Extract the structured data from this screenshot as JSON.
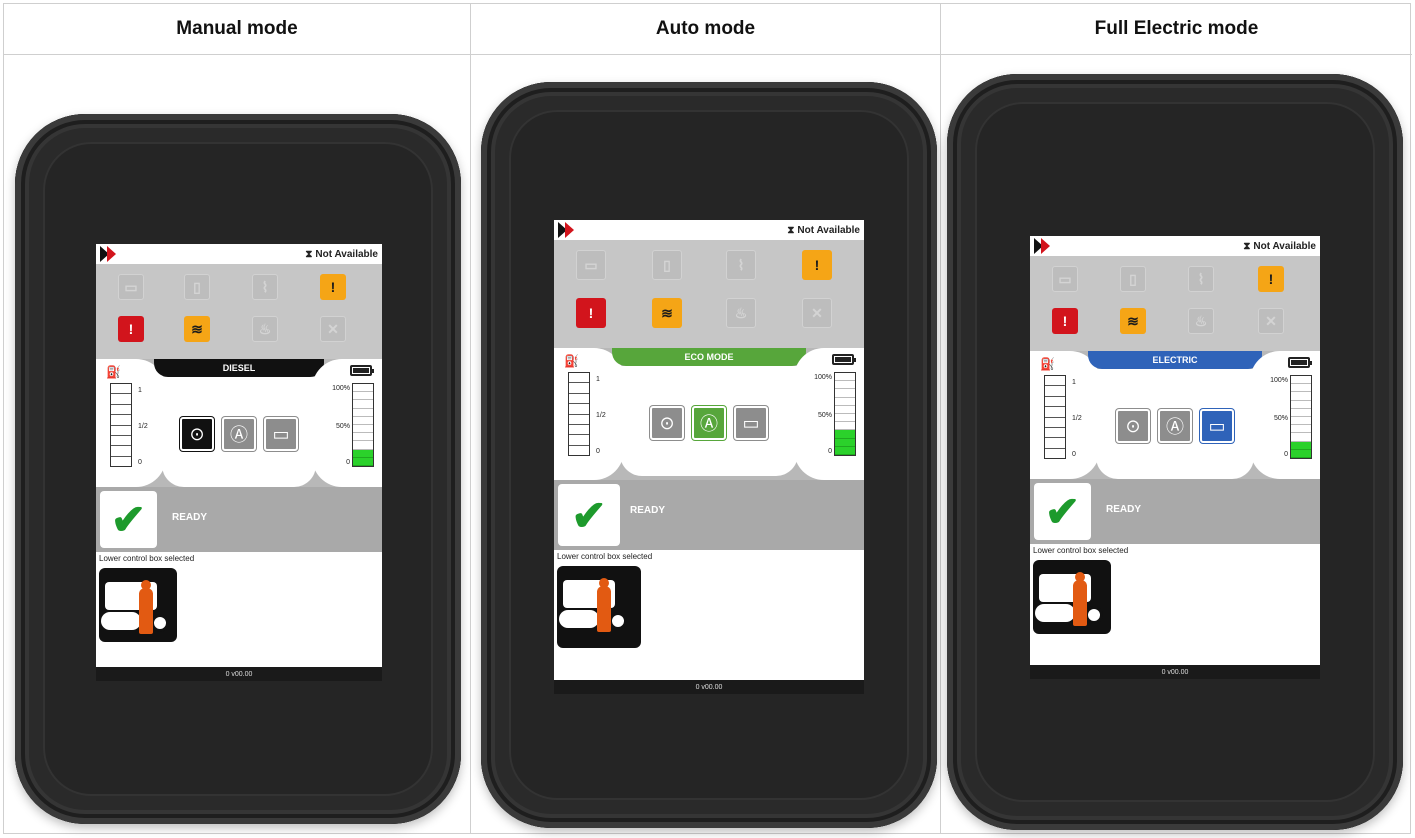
{
  "columns": [
    {
      "heading": "Manual mode",
      "status_text": "Not Available",
      "mode_label": "DIESEL",
      "mode_color": "#111111",
      "active_mode": "diesel",
      "fuel_labels": {
        "full": "1",
        "half": "1/2",
        "empty": "0"
      },
      "battery_labels": {
        "full": "100%",
        "half": "50%",
        "empty": "0"
      },
      "battery_level": 0.2,
      "ready_text": "READY",
      "info_text": "Lower control box selected",
      "footer_text": "0  v00.00"
    },
    {
      "heading": "Auto mode",
      "status_text": "Not Available",
      "mode_label": "ECO MODE",
      "mode_color": "#57a63b",
      "active_mode": "auto",
      "fuel_labels": {
        "full": "1",
        "half": "1/2",
        "empty": "0"
      },
      "battery_labels": {
        "full": "100%",
        "half": "50%",
        "empty": "0"
      },
      "battery_level": 0.3,
      "ready_text": "READY",
      "info_text": "Lower control box selected",
      "footer_text": "0  v00.00"
    },
    {
      "heading": "Full Electric mode",
      "status_text": "Not Available",
      "mode_label": "ELECTRIC",
      "mode_color": "#2f63b9",
      "active_mode": "electric",
      "fuel_labels": {
        "full": "1",
        "half": "1/2",
        "empty": "0"
      },
      "battery_labels": {
        "full": "100%",
        "half": "50%",
        "empty": "0"
      },
      "battery_level": 0.25,
      "ready_text": "READY",
      "info_text": "Lower control box selected",
      "footer_text": "0  v00.00"
    }
  ],
  "warning_icons": [
    {
      "name": "battery-warning-icon",
      "glyph": "▭",
      "state": "dim"
    },
    {
      "name": "fuel-filter-icon",
      "glyph": "▯",
      "state": "dim"
    },
    {
      "name": "oil-pressure-icon",
      "glyph": "⌇",
      "state": "dim"
    },
    {
      "name": "engine-warning-amber-icon",
      "glyph": "!",
      "state": "amber"
    },
    {
      "name": "engine-fault-red-icon",
      "glyph": "!",
      "state": "red"
    },
    {
      "name": "glow-plug-icon",
      "glyph": "≋",
      "state": "amber"
    },
    {
      "name": "coolant-temp-icon",
      "glyph": "♨",
      "state": "dim"
    },
    {
      "name": "fan-off-icon",
      "glyph": "✕",
      "state": "dim"
    }
  ],
  "colors": {
    "amber": "#f5a516",
    "red": "#d2141c",
    "ready_green": "#1d9a2c",
    "battery_green": "#2bd12b"
  }
}
